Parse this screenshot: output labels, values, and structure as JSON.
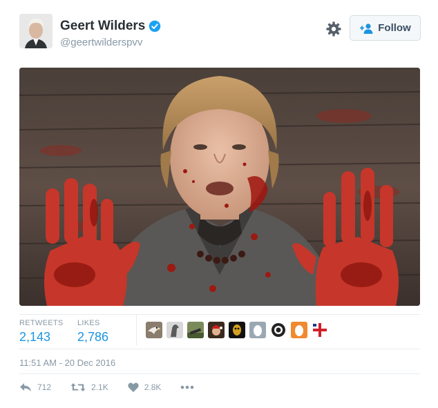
{
  "author": {
    "name": "Geert Wilders",
    "handle": "@geertwilderspvv"
  },
  "header": {
    "follow_label": "Follow"
  },
  "stats": {
    "retweets_label": "RETWEETS",
    "retweets_value": "2,143",
    "likes_label": "LIKES",
    "likes_value": "2,786"
  },
  "likers": [
    "eagle",
    "horse",
    "cannon",
    "santa",
    "mask",
    "egg",
    "empire",
    "egg-orange",
    "cross"
  ],
  "timestamp": "11:51 AM - 20 Dec 2016",
  "actions": {
    "reply_count": "712",
    "retweet_count": "2.1K",
    "like_count": "2.8K"
  },
  "colors": {
    "accent": "#1b95e0",
    "muted": "#8899a6",
    "text": "#292f33"
  }
}
